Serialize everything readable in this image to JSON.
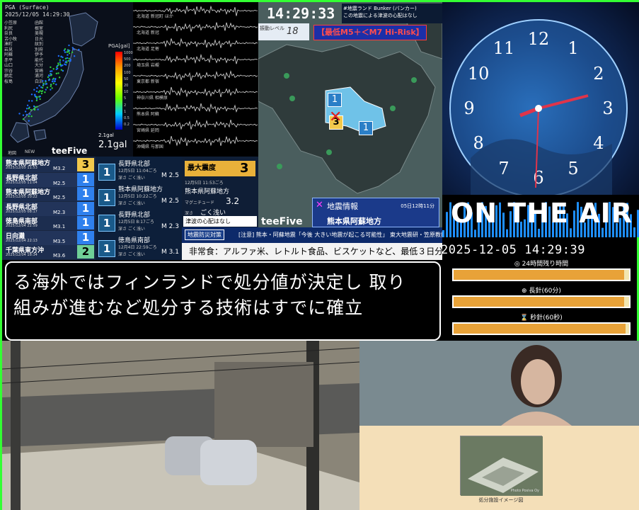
{
  "map_panel": {
    "header_1": "PGA (Surface)",
    "header_2": "2025/12/05 14:29:30",
    "stations": [
      "小笠原",
      "利尻",
      "奈良",
      "苫小牧",
      "湊町",
      "岩見",
      "阿蘇",
      "赤平",
      "山口",
      "宗谷",
      "網走",
      "桜島",
      "函館",
      "根室",
      "美幌",
      "日光",
      "紋別",
      "別府",
      "伊予",
      "能代",
      "大分",
      "宮崎",
      "浦河",
      "白浜"
    ],
    "pga_label": "PGA[gal]",
    "pga_ticks": [
      "1000",
      "500",
      "200",
      "100",
      "50",
      "20",
      "10",
      "5",
      "2",
      "1",
      "0.5",
      "0.2"
    ],
    "pga_small": "2.1gal",
    "pga_value": "2.1gal",
    "new_label": "NEW",
    "brand": "teeFive",
    "map_label": "地図"
  },
  "waveforms": {
    "labels": [
      "北海道 新冠町 ほか",
      "北海道 新冠",
      "北海道 足寄",
      "埼玉県 岩槻",
      "東京都 新宿",
      "神奈川県 相模原",
      "熊本県 阿蘇",
      "宮崎県 延岡",
      "沖縄県 与那国"
    ]
  },
  "eq_list": [
    {
      "place": "熊本県阿蘇地方",
      "date": "2025/12/05 11:53",
      "mag": "M3.2",
      "intensity": "3",
      "color": "#f2c94c"
    },
    {
      "place": "長野県北部",
      "date": "2025/12/05 11:04",
      "mag": "M2.5",
      "intensity": "1",
      "color": "#2f80ed"
    },
    {
      "place": "熊本県阿蘇地方",
      "date": "2025/12/05 10:22",
      "mag": "M2.5",
      "intensity": "1",
      "color": "#2f80ed"
    },
    {
      "place": "長野県北部",
      "date": "2025/12/05 08:17",
      "mag": "M2.3",
      "intensity": "1",
      "color": "#2f80ed"
    },
    {
      "place": "徳島県南部",
      "date": "2025/12/04 22:59",
      "mag": "M3.1",
      "intensity": "1",
      "color": "#2f80ed"
    },
    {
      "place": "日向灘",
      "date": "2025/12/04 22:13",
      "mag": "M3.5",
      "intensity": "1",
      "color": "#2f80ed"
    },
    {
      "place": "千葉県東方沖",
      "date": "2025/12/04 18:34",
      "mag": "M3.6",
      "intensity": "2",
      "color": "#6fcf97"
    }
  ],
  "eq_cards": [
    {
      "badge": "1",
      "title": "長野県北部",
      "sub": "12月5日 11:04ごろ",
      "depth": "深さ ごく浅い",
      "mag": "M 2.5"
    },
    {
      "badge": "1",
      "title": "熊本県阿蘇地方",
      "sub": "12月5日 10:22ごろ",
      "depth": "深さ ごく浅い",
      "mag": "M 2.5"
    },
    {
      "badge": "1",
      "title": "長野県北部",
      "sub": "12月5日 8:17ごろ",
      "depth": "深さ ごく浅い",
      "mag": "M 2.3"
    },
    {
      "badge": "1",
      "title": "徳島県南部",
      "sub": "12月4日 22:59ごろ",
      "depth": "深さ ごく浅い",
      "mag": "M 3.1"
    }
  ],
  "max_panel": {
    "header": "最大震度",
    "value": "3",
    "date": "12月5日 11:53ごろ",
    "place": "熊本県阿蘇地方",
    "mag_label": "マグニチュード",
    "mag": "3.2",
    "depth_label": "深さ",
    "depth": "ごく浅い",
    "tsunami": "津波の心配はなし"
  },
  "kyushu": {
    "time": "14:29:33",
    "bunker_1": "#地震ランド Bunker (バンカー)",
    "bunker_2": "この地震による津波の心配はなし",
    "shindo_label": "振動レベル",
    "shindo_value": "18",
    "risk": "【最低M5＋＜M7 Hi-Risk】",
    "brand": "teeFive",
    "info_x": "✕",
    "info_title": "地震情報",
    "info_date": "05日12時11分",
    "info_place": "熊本県阿蘇地方",
    "markers": [
      "1",
      "3",
      "1"
    ]
  },
  "warning": {
    "tag": "地震防災対策",
    "text": "[注意] 熊本・阿蘇地震「今後 大きい地震が起こる可能性」 東大地震研・笠原教授",
    "emergency": "非常食：アルファ米、レトルト食品、ビスケットなど、最低３日分を"
  },
  "subtitle": {
    "line1": "る海外ではフィンランドで処分値が決定し 取り",
    "line2": "組みが進むなど処分する技術はすでに確立"
  },
  "clock": {
    "numbers": [
      "12",
      "1",
      "2",
      "3",
      "4",
      "5",
      "6",
      "7",
      "8",
      "9",
      "10",
      "11"
    ],
    "on_air": "ON THE AIR",
    "datetime": "2025-12-05 14:29:39",
    "bars": [
      {
        "label": "◎ 24時間残り時間",
        "fill": 0.97
      },
      {
        "label": "⊕ 長針(60分)",
        "fill": 0.97
      },
      {
        "label": "⌛ 秒針(60秒)",
        "fill": 0.98
      }
    ]
  },
  "document": {
    "caption": "処分施設イメージ図",
    "photo_credit": "Photo Posiva Oy"
  }
}
